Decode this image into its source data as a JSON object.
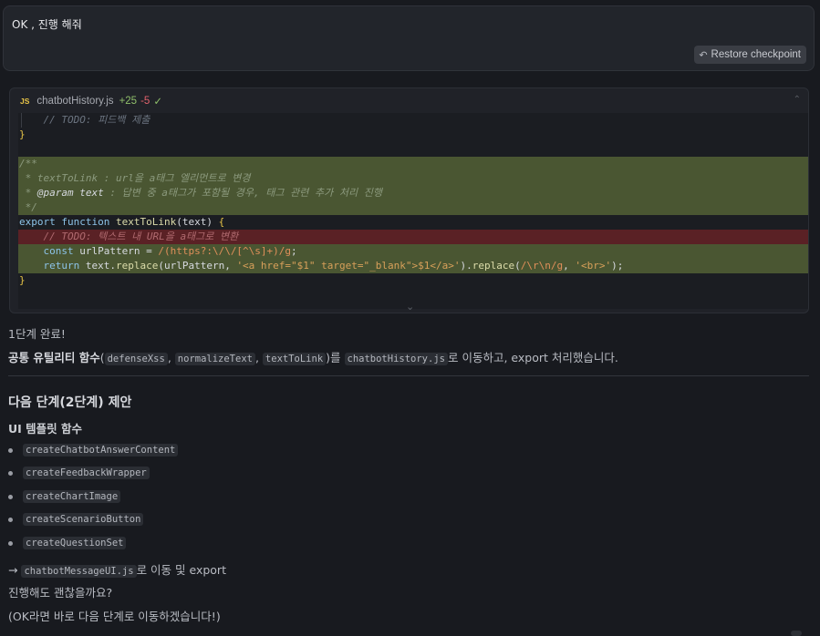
{
  "user_message": {
    "text": "OK , 진행 해줘",
    "restore_label": "Restore checkpoint"
  },
  "code_block": {
    "language_badge": "JS",
    "file_name": "chatbotHistory.js",
    "added": "+25",
    "removed": "-5",
    "status_icon": "check-icon"
  },
  "texts": {
    "step_done": "1단계 완료!",
    "summary_bold": "공통 유틸리티 함수",
    "summary_open": "(",
    "fn1": "defenseXss",
    "comma1": ", ",
    "fn2": "normalizeText",
    "comma2": ", ",
    "fn3": "textToLink",
    "summary_mid": ")를 ",
    "file": "chatbotHistory.js",
    "summary_end": "로 이동하고, export 처리했습니다.",
    "next_heading": "다음 단계(2단계) 제안",
    "ui_heading": "UI 템플릿 함수",
    "functions": [
      "createChatbotAnswerContent",
      "createFeedbackWrapper",
      "createChartImage",
      "createScenarioButton",
      "createQuestionSet"
    ],
    "move_arrow": "→ ",
    "move_file": "chatbotMessageUI.js",
    "move_end": "로 이동 및 export",
    "question": "진행해도 괜찮을까요?",
    "ok_note": "(OK라면 바로 다음 단계로 이동하겠습니다!)"
  }
}
